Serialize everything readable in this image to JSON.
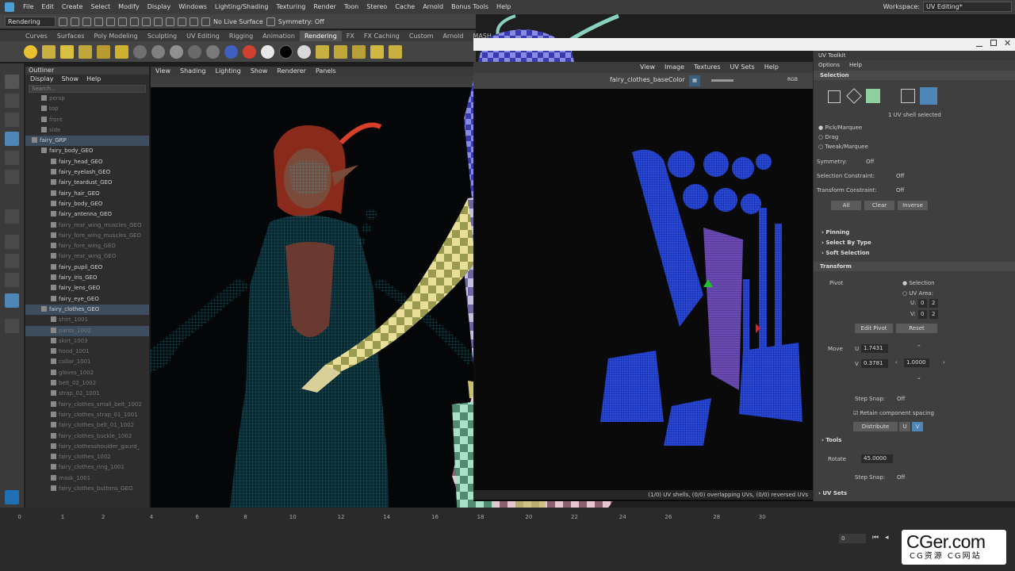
{
  "menubar": {
    "items": [
      "File",
      "Edit",
      "Create",
      "Select",
      "Modify",
      "Display",
      "Windows",
      "Lighting/Shading",
      "Texturing",
      "Render",
      "Toon",
      "Stereo",
      "Cache",
      "Arnold",
      "Bonus Tools",
      "Help"
    ],
    "workspace_label": "Workspace:",
    "workspace_value": "UV Editing*"
  },
  "statusline": {
    "menuset": "Rendering",
    "live_surface": "No Live Surface",
    "symmetry": "Symmetry: Off"
  },
  "shelf": {
    "tabs": [
      "Curves",
      "Surfaces",
      "Poly Modeling",
      "Sculpting",
      "UV Editing",
      "Rigging",
      "Animation",
      "Rendering",
      "FX",
      "FX Caching",
      "Custom",
      "Arnold",
      "MASH"
    ],
    "active_tab": "Rendering"
  },
  "outliner": {
    "tab": "Outliner",
    "menu": [
      "Display",
      "Show",
      "Help"
    ],
    "search_placeholder": "Search...",
    "items": [
      {
        "label": "persp",
        "indent": 1,
        "dim": true
      },
      {
        "label": "top",
        "indent": 1,
        "dim": true
      },
      {
        "label": "front",
        "indent": 1,
        "dim": true
      },
      {
        "label": "side",
        "indent": 1,
        "dim": true
      },
      {
        "label": "fairy_GRP",
        "indent": 0,
        "hl": true
      },
      {
        "label": "fairy_body_GEO",
        "indent": 1
      },
      {
        "label": "fairy_head_GEO",
        "indent": 2
      },
      {
        "label": "fairy_eyelash_GEO",
        "indent": 2
      },
      {
        "label": "fairy_teardust_GEO",
        "indent": 2
      },
      {
        "label": "fairy_hair_GEO",
        "indent": 2
      },
      {
        "label": "fairy_body_GEO",
        "indent": 2
      },
      {
        "label": "fairy_antenna_GEO",
        "indent": 2
      },
      {
        "label": "fairy_rear_wing_muscles_GEO",
        "indent": 2,
        "dim": true
      },
      {
        "label": "fairy_fore_wing_muscles_GEO",
        "indent": 2,
        "dim": true
      },
      {
        "label": "fairy_fore_wing_GEO",
        "indent": 2,
        "dim": true
      },
      {
        "label": "fairy_rear_wing_GEO",
        "indent": 2,
        "dim": true
      },
      {
        "label": "fairy_pupil_GEO",
        "indent": 2
      },
      {
        "label": "fairy_iris_GEO",
        "indent": 2
      },
      {
        "label": "fairy_lens_GEO",
        "indent": 2
      },
      {
        "label": "fairy_eye_GEO",
        "indent": 2
      },
      {
        "label": "fairy_clothes_GEO",
        "indent": 1,
        "hl": true
      },
      {
        "label": "shirt_1001",
        "indent": 2,
        "dim": true
      },
      {
        "label": "pants_1002",
        "indent": 2,
        "dim": true,
        "hl": true
      },
      {
        "label": "skirt_1003",
        "indent": 2,
        "dim": true
      },
      {
        "label": "hood_1001",
        "indent": 2,
        "dim": true
      },
      {
        "label": "collar_1001",
        "indent": 2,
        "dim": true
      },
      {
        "label": "gloves_1002",
        "indent": 2,
        "dim": true
      },
      {
        "label": "belt_02_1002",
        "indent": 2,
        "dim": true
      },
      {
        "label": "strap_02_1001",
        "indent": 2,
        "dim": true
      },
      {
        "label": "fairy_clothes_small_belt_1002",
        "indent": 2,
        "dim": true
      },
      {
        "label": "fairy_clothes_strap_01_1001",
        "indent": 2,
        "dim": true
      },
      {
        "label": "fairy_clothes_belt_01_1002",
        "indent": 2,
        "dim": true
      },
      {
        "label": "fairy_clothes_buckle_1002",
        "indent": 2,
        "dim": true
      },
      {
        "label": "fairy_clothesshoulder_gaurd_",
        "indent": 2,
        "dim": true
      },
      {
        "label": "fairy_clothes_1002",
        "indent": 2,
        "dim": true
      },
      {
        "label": "fairy_clothes_ring_1001",
        "indent": 2,
        "dim": true
      },
      {
        "label": "mask_1001",
        "indent": 2,
        "dim": true
      },
      {
        "label": "fairy_clothes_buttons_GEO",
        "indent": 2,
        "dim": true
      }
    ]
  },
  "viewport": {
    "menu": [
      "View",
      "Shading",
      "Lighting",
      "Show",
      "Renderer",
      "Panels"
    ]
  },
  "uv_editor": {
    "menu": [
      "View",
      "Image",
      "Textures",
      "UV Sets",
      "Help"
    ],
    "texture": "fairy_clothes_baseColor",
    "channel": "RGB",
    "status": "(1/0) UV shells, (0/0) overlapping UVs, (0/0) reversed UVs"
  },
  "toolkit": {
    "title": "UV Toolkit",
    "menu": [
      "Options",
      "Help"
    ],
    "selection_header": "Selection",
    "selected_text": "1 UV shell selected",
    "select_modes": [
      "Pick/Marquee",
      "Drag",
      "Tweak/Marquee"
    ],
    "symmetry_label": "Symmetry:",
    "symmetry_value": "Off",
    "selection_constraint_label": "Selection Constraint:",
    "selection_constraint_value": "Off",
    "transform_constraint_label": "Transform Constraint:",
    "transform_constraint_value": "Off",
    "buttons": [
      "All",
      "Clear",
      "Inverse"
    ],
    "subsections": [
      "Pinning",
      "Select By Type",
      "Soft Selection"
    ],
    "transform_header": "Transform",
    "pivot_label": "Pivot",
    "pivot_selection": "Selection",
    "pivot_uv_area": "UV Area:",
    "uv_area_u_label": "U:",
    "uv_area_v_label": "V:",
    "uv_area_u": [
      "0",
      "2"
    ],
    "uv_area_v": [
      "0",
      "2"
    ],
    "edit_pivot": "Edit Pivot",
    "reset": "Reset",
    "move_label": "Move",
    "move_u_label": "U",
    "move_v_label": "V",
    "move_u": "1.7431",
    "move_v": "0.3781",
    "move_step": "1.0000",
    "step_snap_label": "Step Snap:",
    "step_snap_value": "Off",
    "retain_spacing": "Retain component spacing",
    "distribute": "Distribute",
    "distribute_u": "U",
    "distribute_v": "V",
    "tools_header": "Tools",
    "rotate_label": "Rotate",
    "rotate_value": "45.0000",
    "step_snap2_label": "Step Snap:",
    "step_snap2_value": "Off",
    "uv_sets_header": "UV Sets"
  },
  "timeline": {
    "ticks": [
      "0",
      "1",
      "2",
      "4",
      "6",
      "8",
      "10",
      "12",
      "14",
      "16",
      "18",
      "20",
      "22",
      "24",
      "26",
      "28",
      "30"
    ],
    "current": "0"
  },
  "watermark": {
    "big": "CGer.com",
    "small": "CG资源 CG网站"
  },
  "colors": {
    "accent": "#4a9fd8",
    "wire_cyan": "#2ec8d8",
    "uv_blue": "#2840c8"
  }
}
